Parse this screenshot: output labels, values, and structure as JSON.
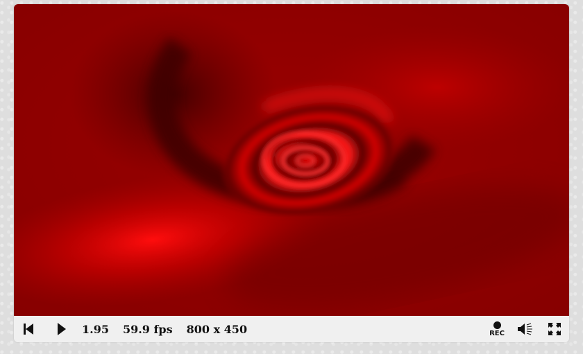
{
  "player": {
    "time": "1.95",
    "fps": "59.9 fps",
    "resolution": "800 x 450",
    "rec_label": "REC"
  },
  "icons": {
    "rewind": "skip-to-start-icon",
    "play": "play-icon",
    "record": "record-icon",
    "volume": "volume-icon",
    "fullscreen": "fullscreen-icon"
  },
  "colors": {
    "canvas_base": "#8a0000",
    "canvas_highlight": "#ff1a1a",
    "canvas_shadow": "#3a0000",
    "controls_bg": "#f0f0f0",
    "icon": "#111111"
  }
}
